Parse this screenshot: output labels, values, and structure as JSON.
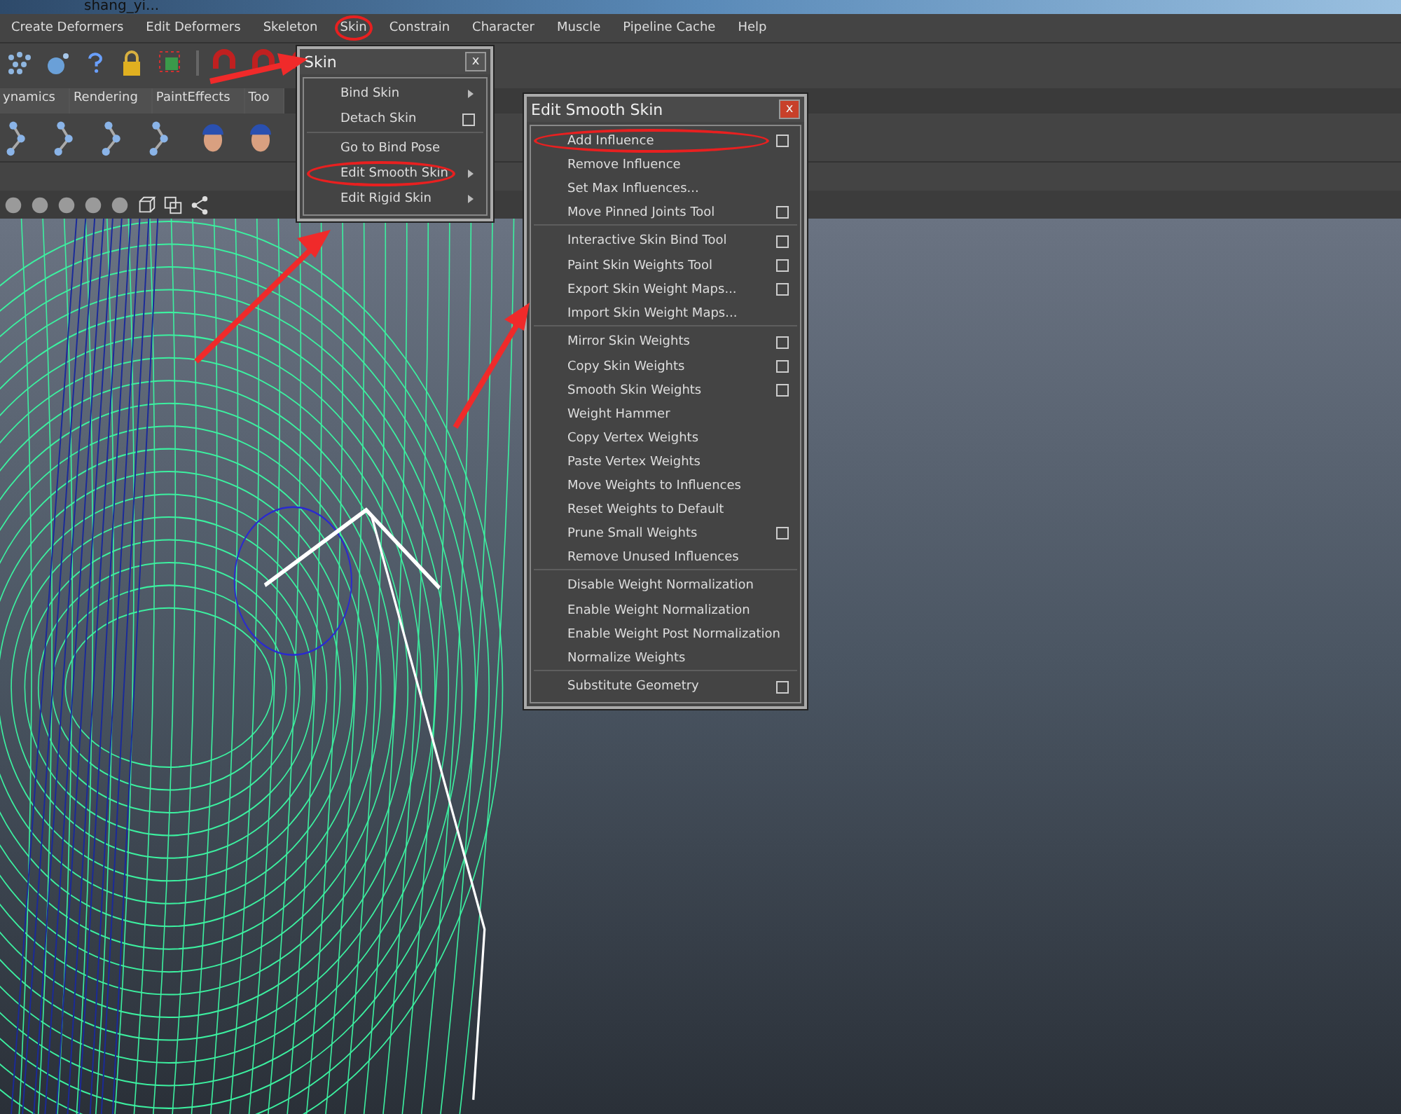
{
  "window": {
    "title": "shang_yi..."
  },
  "menu_bar": [
    {
      "label": "Create Deformers",
      "circled": false
    },
    {
      "label": "Edit Deformers",
      "circled": false
    },
    {
      "label": "Skeleton",
      "circled": false
    },
    {
      "label": "Skin",
      "circled": true
    },
    {
      "label": "Constrain",
      "circled": false
    },
    {
      "label": "Character",
      "circled": false
    },
    {
      "label": "Muscle",
      "circled": false
    },
    {
      "label": "Pipeline Cache",
      "circled": false
    },
    {
      "label": "Help",
      "circled": false
    }
  ],
  "shelf_tabs": [
    {
      "label": "ynamics",
      "selected": false
    },
    {
      "label": "Rendering",
      "selected": false
    },
    {
      "label": "PaintEffects",
      "selected": false
    },
    {
      "label": "Too",
      "selected": false
    }
  ],
  "skin_menu": {
    "title": "Skin",
    "close": "x",
    "items": [
      {
        "label": "Bind Skin",
        "submenu": true,
        "option_box": false,
        "separator_before": false,
        "circled": false
      },
      {
        "label": "Detach Skin",
        "submenu": false,
        "option_box": true,
        "separator_before": false,
        "circled": false
      },
      {
        "label": "Go to Bind Pose",
        "submenu": false,
        "option_box": false,
        "separator_before": true,
        "circled": false
      },
      {
        "label": "Edit Smooth Skin",
        "submenu": true,
        "option_box": false,
        "separator_before": false,
        "circled": true
      },
      {
        "label": "Edit Rigid Skin",
        "submenu": true,
        "option_box": false,
        "separator_before": false,
        "circled": false
      }
    ]
  },
  "smooth_skin_menu": {
    "title": "Edit Smooth Skin",
    "close": "x",
    "items": [
      {
        "label": "Add Influence",
        "submenu": false,
        "option_box": true,
        "separator_before": false,
        "circled": true
      },
      {
        "label": "Remove Influence",
        "submenu": false,
        "option_box": false,
        "separator_before": false,
        "circled": false
      },
      {
        "label": "Set Max Influences...",
        "submenu": false,
        "option_box": false,
        "separator_before": false,
        "circled": false
      },
      {
        "label": "Move Pinned Joints Tool",
        "submenu": false,
        "option_box": true,
        "separator_before": false,
        "circled": false
      },
      {
        "label": "Interactive Skin Bind Tool",
        "submenu": false,
        "option_box": true,
        "separator_before": true,
        "circled": false
      },
      {
        "label": "Paint Skin Weights Tool",
        "submenu": false,
        "option_box": true,
        "separator_before": false,
        "circled": false
      },
      {
        "label": "Export Skin Weight Maps...",
        "submenu": false,
        "option_box": true,
        "separator_before": false,
        "circled": false
      },
      {
        "label": "Import Skin Weight Maps...",
        "submenu": false,
        "option_box": false,
        "separator_before": false,
        "circled": false
      },
      {
        "label": "Mirror Skin Weights",
        "submenu": false,
        "option_box": true,
        "separator_before": true,
        "circled": false
      },
      {
        "label": "Copy Skin Weights",
        "submenu": false,
        "option_box": true,
        "separator_before": false,
        "circled": false
      },
      {
        "label": "Smooth Skin Weights",
        "submenu": false,
        "option_box": true,
        "separator_before": false,
        "circled": false
      },
      {
        "label": "Weight Hammer",
        "submenu": false,
        "option_box": false,
        "separator_before": false,
        "circled": false
      },
      {
        "label": "Copy Vertex Weights",
        "submenu": false,
        "option_box": false,
        "separator_before": false,
        "circled": false
      },
      {
        "label": "Paste Vertex Weights",
        "submenu": false,
        "option_box": false,
        "separator_before": false,
        "circled": false
      },
      {
        "label": "Move Weights to Influences",
        "submenu": false,
        "option_box": false,
        "separator_before": false,
        "circled": false
      },
      {
        "label": "Reset Weights to Default",
        "submenu": false,
        "option_box": false,
        "separator_before": false,
        "circled": false
      },
      {
        "label": "Prune Small Weights",
        "submenu": false,
        "option_box": true,
        "separator_before": false,
        "circled": false
      },
      {
        "label": "Remove Unused Influences",
        "submenu": false,
        "option_box": false,
        "separator_before": false,
        "circled": false
      },
      {
        "label": "Disable Weight Normalization",
        "submenu": false,
        "option_box": false,
        "separator_before": true,
        "circled": false
      },
      {
        "label": "Enable Weight Normalization",
        "submenu": false,
        "option_box": false,
        "separator_before": false,
        "circled": false
      },
      {
        "label": "Enable Weight Post Normalization",
        "submenu": false,
        "option_box": false,
        "separator_before": false,
        "circled": false
      },
      {
        "label": "Normalize Weights",
        "submenu": false,
        "option_box": false,
        "separator_before": false,
        "circled": false
      },
      {
        "label": "Substitute Geometry",
        "submenu": false,
        "option_box": true,
        "separator_before": true,
        "circled": false
      }
    ]
  }
}
